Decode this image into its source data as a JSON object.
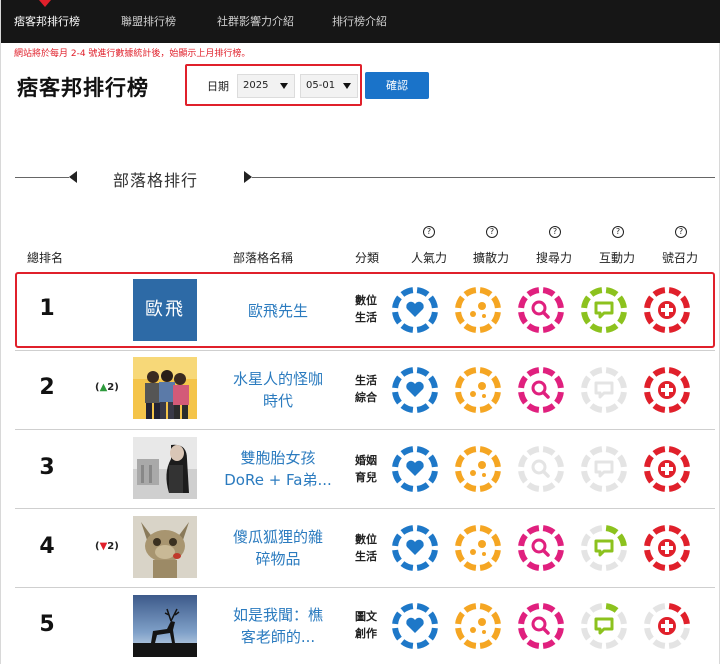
{
  "nav": {
    "items": [
      "痞客邦排行榜",
      "聯盟排行榜",
      "社群影響力介紹",
      "排行榜介紹"
    ],
    "active_index": 0
  },
  "notice": "網站將於每月 2-4 號進行數據統計後，始顯示上月排行榜。",
  "page_title": "痞客邦排行榜",
  "filter": {
    "date_label": "日期",
    "year": "2025",
    "month": "05-01",
    "confirm_label": "確認"
  },
  "section_title": "部落格排行",
  "columns": {
    "rank": "總排名",
    "blog_name": "部落格名稱",
    "category": "分類",
    "popularity": "人氣力",
    "spread": "擴散力",
    "search": "搜尋力",
    "interaction": "互動力",
    "appeal": "號召力"
  },
  "help_icon": "?",
  "metric_colors": {
    "popularity": "#1e78c8",
    "spread": "#f5a623",
    "search": "#e0207e",
    "interaction": "#8cc21e",
    "appeal": "#e0202b",
    "empty": "#e4e4e4"
  },
  "metric_icons": [
    "heart-icon",
    "share-icon",
    "search-icon",
    "comment-icon",
    "plus-icon"
  ],
  "rows": [
    {
      "rank": "1",
      "change": "",
      "change_dir": "",
      "blog_name_lines": [
        "歐飛先生",
        ""
      ],
      "category_lines": [
        "數位",
        "生活"
      ],
      "thumb_text": "歐飛",
      "levels": [
        8,
        8,
        8,
        8,
        8
      ]
    },
    {
      "rank": "2",
      "change": "2",
      "change_dir": "up",
      "blog_name_lines": [
        "水星人的怪咖",
        "時代"
      ],
      "category_lines": [
        "生活",
        "綜合"
      ],
      "thumb_text": "",
      "levels": [
        8,
        8,
        8,
        0,
        8
      ]
    },
    {
      "rank": "3",
      "change": "",
      "change_dir": "",
      "blog_name_lines": [
        "雙胞胎女孩",
        "DoRe + Fa弟..."
      ],
      "category_lines": [
        "婚姻",
        "育兒"
      ],
      "thumb_text": "",
      "levels": [
        8,
        8,
        0,
        0,
        8
      ]
    },
    {
      "rank": "4",
      "change": "2",
      "change_dir": "down",
      "blog_name_lines": [
        "傻瓜狐狸的雜",
        "碎物品"
      ],
      "category_lines": [
        "數位",
        "生活"
      ],
      "thumb_text": "",
      "levels": [
        8,
        8,
        8,
        2,
        8
      ]
    },
    {
      "rank": "5",
      "change": "",
      "change_dir": "",
      "blog_name_lines": [
        "如是我聞：樵",
        "客老師的..."
      ],
      "category_lines": [
        "圖文",
        "創作"
      ],
      "thumb_text": "",
      "levels": [
        8,
        8,
        8,
        1,
        2
      ]
    }
  ]
}
